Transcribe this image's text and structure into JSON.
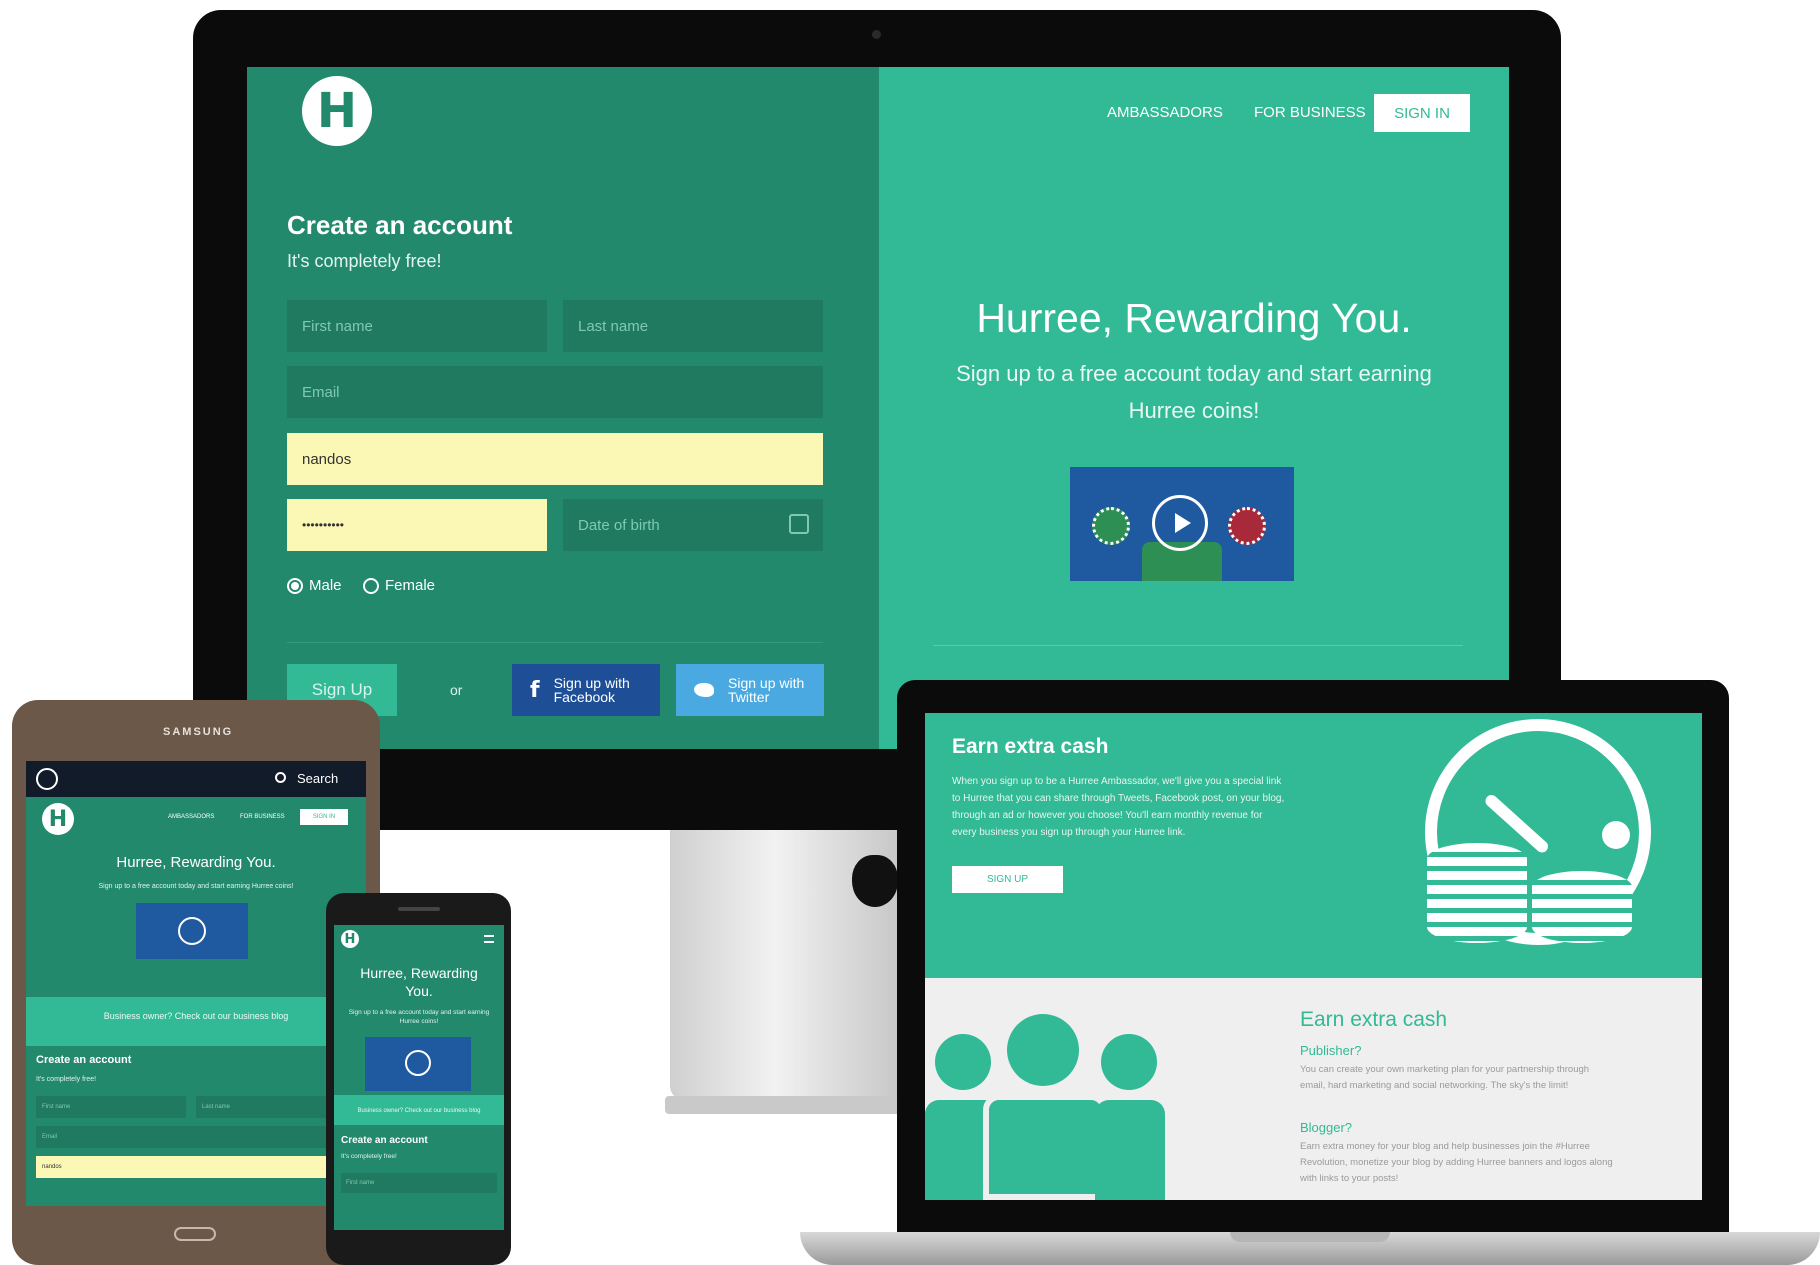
{
  "desktop": {
    "nav": {
      "ambassadors": "AMBASSADORS",
      "for_business": "FOR BUSINESS",
      "sign_in": "SIGN IN"
    },
    "form": {
      "title": "Create an account",
      "subtitle": "It's completely free!",
      "first_name_placeholder": "First name",
      "last_name_placeholder": "Last name",
      "email_placeholder": "Email",
      "username_value": "nandos",
      "password_value": "••••••••••",
      "dob_placeholder": "Date of birth",
      "gender_male": "Male",
      "gender_female": "Female",
      "gender_selected": "Male",
      "signup_label": "Sign Up",
      "or_label": "or",
      "facebook_label_1": "Sign up with",
      "facebook_label_2": "Facebook",
      "twitter_label_1": "Sign up with",
      "twitter_label_2": "Twitter"
    },
    "hero": {
      "title": "Hurree, Rewarding You.",
      "subtitle_1": "Sign up to a free account today and start earning",
      "subtitle_2": "Hurree coins!"
    },
    "logo_letter": "H"
  },
  "laptop": {
    "banner_title": "Earn extra cash",
    "banner_text_1": "When you sign up to be a Hurree Ambassador, we'll give you a special link",
    "banner_text_2": "to Hurree that you can share through Tweets, Facebook post, on your blog,",
    "banner_text_3": "through an ad or however you choose! You'll earn monthly revenue for",
    "banner_text_4": "every business you sign up through your Hurree link.",
    "signup_label": "SIGN UP",
    "section_title": "Earn extra cash",
    "publisher_title": "Publisher?",
    "publisher_text_1": "You can create your own marketing plan for your partnership through",
    "publisher_text_2": "email, hard marketing and social networking. The sky's the limit!",
    "blogger_title": "Blogger?",
    "blogger_text_1": "Earn extra money for your blog and help businesses join the #Hurree",
    "blogger_text_2": "Revolution, monetize your blog by adding Hurree banners and logos along",
    "blogger_text_3": "with links to your posts!"
  },
  "tablet": {
    "brand": "SAMSUNG",
    "search_label": "Search",
    "nav_ambassadors": "AMBASSADORS",
    "nav_business": "FOR BUSINESS",
    "nav_sign_in": "SIGN IN",
    "hero_title": "Hurree, Rewarding You.",
    "hero_sub": "Sign up to a free account today and start earning Hurree coins!",
    "business_link": "Business owner? Check out our business blog",
    "form_title": "Create an account",
    "form_sub": "It's completely free!",
    "first_name": "First name",
    "last_name": "Last name",
    "email": "Email",
    "username": "nandos"
  },
  "phone": {
    "hero_title_1": "Hurree, Rewarding",
    "hero_title_2": "You.",
    "hero_sub": "Sign up to a free account today and start earning Hurree coins!",
    "business_link": "Business owner? Check out our business blog",
    "form_title": "Create an account",
    "form_sub": "It's completely free!",
    "first_name": "First name"
  },
  "colors": {
    "brand_green": "#32b995",
    "dark_green": "#23896c",
    "facebook": "#1e4f96",
    "twitter": "#4aa9e0",
    "autofill": "#fbf7b4"
  },
  "icons": [
    "calendar-icon",
    "facebook-icon",
    "twitter-icon",
    "play-icon",
    "clock-icon",
    "coins-icon",
    "people-icon",
    "search-icon",
    "menu-icon"
  ]
}
